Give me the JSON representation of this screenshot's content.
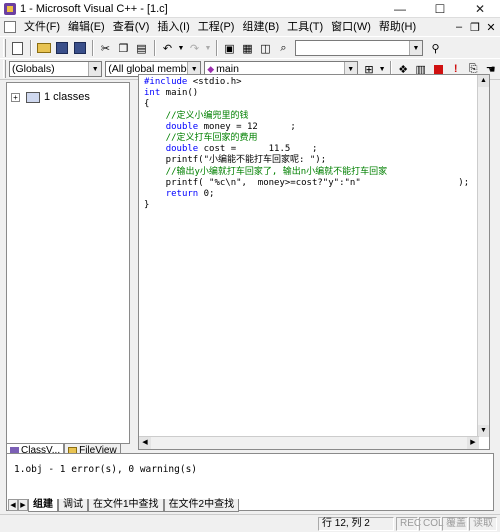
{
  "window": {
    "title": "1 - Microsoft Visual C++ - [1.c]",
    "minimize": "—",
    "maximize": "☐",
    "close": "✕"
  },
  "menu": [
    "文件(F)",
    "编辑(E)",
    "查看(V)",
    "插入(I)",
    "工程(P)",
    "组建(B)",
    "工具(T)",
    "窗口(W)",
    "帮助(H)"
  ],
  "mdi_controls": [
    "–",
    "❐",
    "✕"
  ],
  "toolbar1": {
    "find_value": ""
  },
  "toolbar2": {
    "scope": "(Globals)",
    "members": "(All global members",
    "function": "main"
  },
  "workspace": {
    "tree_item": "1 classes",
    "tabs": [
      "ClassV...",
      "FileView"
    ]
  },
  "editor": {
    "lines": [
      [
        {
          "t": "kw",
          "s": "#include"
        },
        {
          "t": "tx",
          "s": " <stdio.h>"
        }
      ],
      [
        {
          "t": "kw",
          "s": "int"
        },
        {
          "t": "tx",
          "s": " main()"
        }
      ],
      [
        {
          "t": "tx",
          "s": "{"
        }
      ],
      [
        {
          "t": "cm",
          "s": "    //定义小编兜里的钱"
        }
      ],
      [
        {
          "t": "tx",
          "s": "    "
        },
        {
          "t": "kw",
          "s": "double"
        },
        {
          "t": "tx",
          "s": " money = 12      ;"
        }
      ],
      [
        {
          "t": "cm",
          "s": "    //定义打车回家的费用"
        }
      ],
      [
        {
          "t": "tx",
          "s": "    "
        },
        {
          "t": "kw",
          "s": "double"
        },
        {
          "t": "tx",
          "s": " cost =      11.5    ;"
        }
      ],
      [
        {
          "t": "tx",
          "s": "    printf(\"小编能不能打车回家呢: \");"
        }
      ],
      [
        {
          "t": "cm",
          "s": "    //输出y小编就打车回家了, 输出n小编就不能打车回家"
        }
      ],
      [
        {
          "t": "tx",
          "s": "    printf( \"%c\\n\",  money>=cost?\"y\":\"n\"                  );"
        }
      ],
      [
        {
          "t": "tx",
          "s": "    "
        },
        {
          "t": "kw",
          "s": "return"
        },
        {
          "t": "tx",
          "s": " 0;"
        }
      ],
      [
        {
          "t": "tx",
          "s": "}"
        }
      ]
    ]
  },
  "output": {
    "message": "1.obj - 1 error(s), 0 warning(s)",
    "tabs": [
      "组建",
      "调试",
      "在文件1中查找",
      "在文件2中查找"
    ]
  },
  "status": {
    "position": "行 12, 列 2",
    "rec": "REC",
    "col": "COL",
    "ovr": "覆盖",
    "read": "读取"
  }
}
